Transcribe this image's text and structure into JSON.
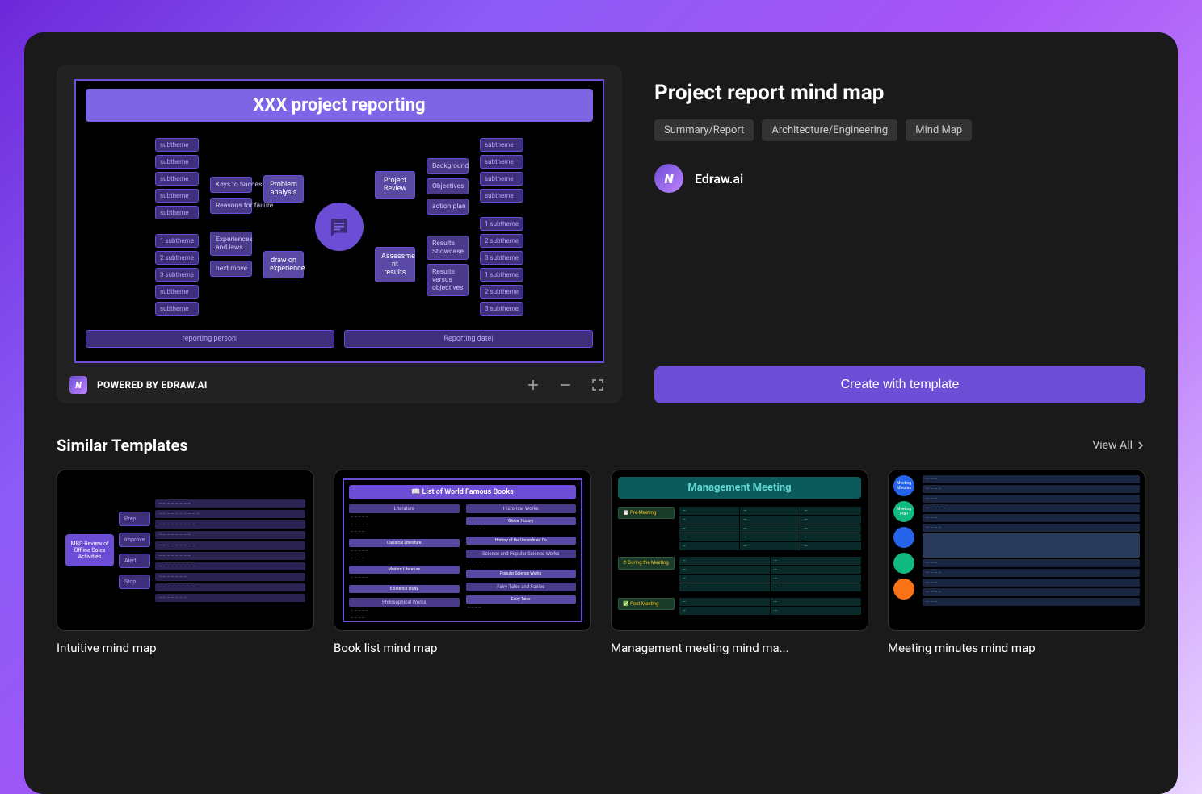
{
  "preview": {
    "mindmap": {
      "title": "XXX project reporting",
      "left_subthemes": [
        "subtheme",
        "subtheme",
        "subtheme",
        "subtheme",
        "subtheme"
      ],
      "left_numbered": [
        "1  subtheme",
        "2  subtheme",
        "3  subtheme",
        "subtheme",
        "subtheme"
      ],
      "left_mid1": "Keys to Success",
      "left_mid2": "Reasons for failure",
      "left_mid3": "Experiences and laws",
      "left_mid4": "next move",
      "left_main1": "Problem analysis",
      "left_main2": "draw on experience",
      "right_main1": "Project Review",
      "right_main2": "Assessme nt results",
      "right_mid1": "Background",
      "right_mid2": "Objectives",
      "right_mid3": "action plan",
      "right_mid4": "Results Showcase",
      "right_mid5": "Results versus objectives",
      "right_subthemes1": [
        "subtheme",
        "subtheme",
        "subtheme",
        "subtheme"
      ],
      "right_subthemes2": [
        "1  subtheme",
        "2  subtheme",
        "3  subtheme",
        "1  subtheme",
        "2  subtheme",
        "3  subtheme"
      ],
      "footer1": "reporting person|",
      "footer2": "Reporting date|"
    },
    "powered_by": "POWERED BY EDRAW.AI"
  },
  "info": {
    "title": "Project report mind map",
    "tags": [
      "Summary/Report",
      "Architecture/Engineering",
      "Mind Map"
    ],
    "author": "Edraw.ai",
    "create_button": "Create with template"
  },
  "similar": {
    "heading": "Similar Templates",
    "view_all": "View All",
    "cards": [
      {
        "label": "Intuitive mind map"
      },
      {
        "label": "Book list mind map"
      },
      {
        "label": "Management meeting mind ma..."
      },
      {
        "label": "Meeting minutes mind map"
      }
    ],
    "thumb1": {
      "center": "MBD Review of Offline Sales Activities",
      "mids": [
        "Prep",
        "Improve",
        "Alert",
        "Stop"
      ]
    },
    "thumb2": {
      "title": "📖 List of World Famous Books",
      "col1_header": "Literature",
      "col2_header": "Historical Works",
      "tags1": [
        "Classical Literature",
        "Modern Literature",
        "Existence study"
      ],
      "tags2": [
        "Global History",
        "History of the Unconfined Co",
        "Popular Science Works",
        "Fairy Tales"
      ],
      "section2": "Science and Popular Science Works",
      "section3": "Philosophical Works",
      "section4": "Fairy Tales and Fables"
    },
    "thumb3": {
      "title": "Management Meeting",
      "labels": [
        "📋 Pre-Meeting",
        "⏱ During the Meeting",
        "✅ Post-Meeting"
      ]
    },
    "thumb4": {
      "circles": [
        {
          "color": "#2563eb",
          "text": "Meeting Minutes"
        },
        {
          "color": "#10b981",
          "text": "Meeting Plan"
        },
        {
          "color": "#2563eb",
          "text": ""
        },
        {
          "color": "#10b981",
          "text": ""
        },
        {
          "color": "#f97316",
          "text": ""
        }
      ]
    }
  }
}
